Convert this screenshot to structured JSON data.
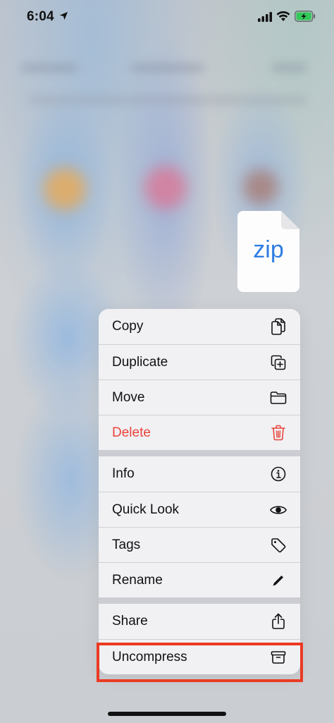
{
  "status_bar": {
    "time": "6:04"
  },
  "file": {
    "type_label": "zip"
  },
  "menu": {
    "groups": [
      [
        {
          "label": "Copy",
          "icon": "doc-on-doc-icon"
        },
        {
          "label": "Duplicate",
          "icon": "plus-square-on-square-icon"
        },
        {
          "label": "Move",
          "icon": "folder-icon"
        },
        {
          "label": "Delete",
          "icon": "trash-icon",
          "destructive": true
        }
      ],
      [
        {
          "label": "Info",
          "icon": "info-circle-icon"
        },
        {
          "label": "Quick Look",
          "icon": "eye-icon"
        },
        {
          "label": "Tags",
          "icon": "tag-icon"
        },
        {
          "label": "Rename",
          "icon": "pencil-icon"
        }
      ],
      [
        {
          "label": "Share",
          "icon": "share-icon"
        },
        {
          "label": "Uncompress",
          "icon": "archive-box-icon",
          "highlighted": true
        }
      ]
    ]
  },
  "colors": {
    "destructive": "#e8443b",
    "highlight": "#ea3a23",
    "accent": "#2f7de3"
  }
}
